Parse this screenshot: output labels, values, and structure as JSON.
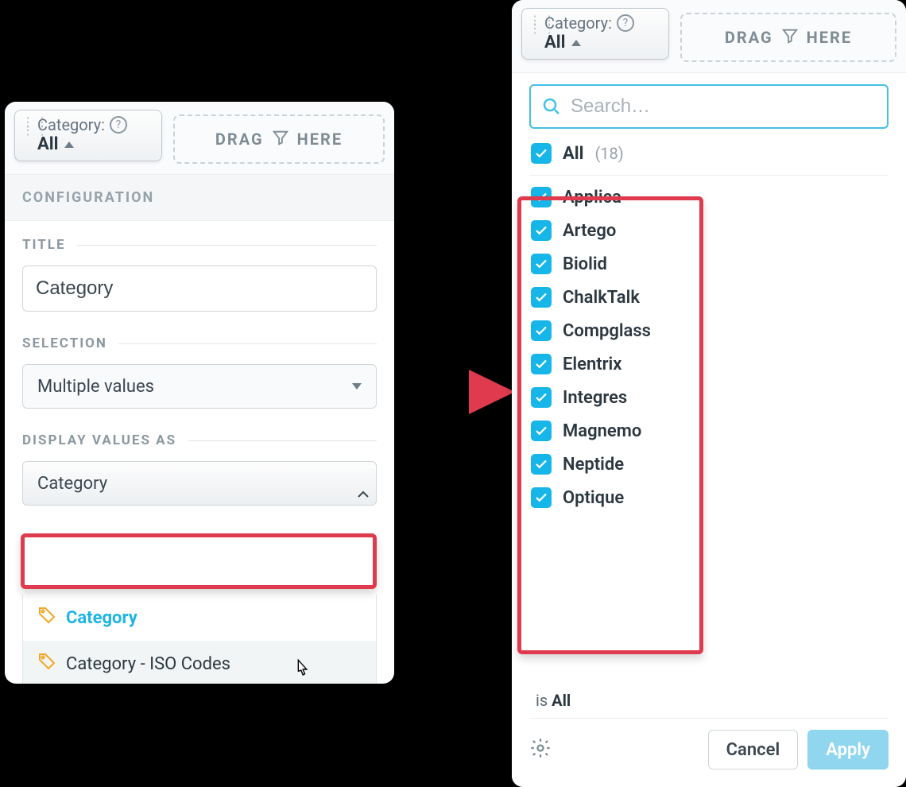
{
  "chip": {
    "label": "Category:",
    "value": "All"
  },
  "dropzone": {
    "drag": "DRAG",
    "here": "HERE"
  },
  "left": {
    "configHeader": "CONFIGURATION",
    "titleLabel": "TITLE",
    "titleValue": "Category",
    "selectionLabel": "SELECTION",
    "selectionValue": "Multiple values",
    "displayLabel": "DISPLAY VALUES AS",
    "displayValue": "Category",
    "options": [
      "Category",
      "Category - ISO Codes"
    ]
  },
  "right": {
    "searchPlaceholder": "Search…",
    "allLabel": "All",
    "allCount": "(18)",
    "items": [
      "Applica",
      "Artego",
      "Biolid",
      "ChalkTalk",
      "Compglass",
      "Elentrix",
      "Integres",
      "Magnemo",
      "Neptide",
      "Optique"
    ],
    "statusPrefix": "is ",
    "statusValue": "All",
    "cancel": "Cancel",
    "apply": "Apply"
  }
}
